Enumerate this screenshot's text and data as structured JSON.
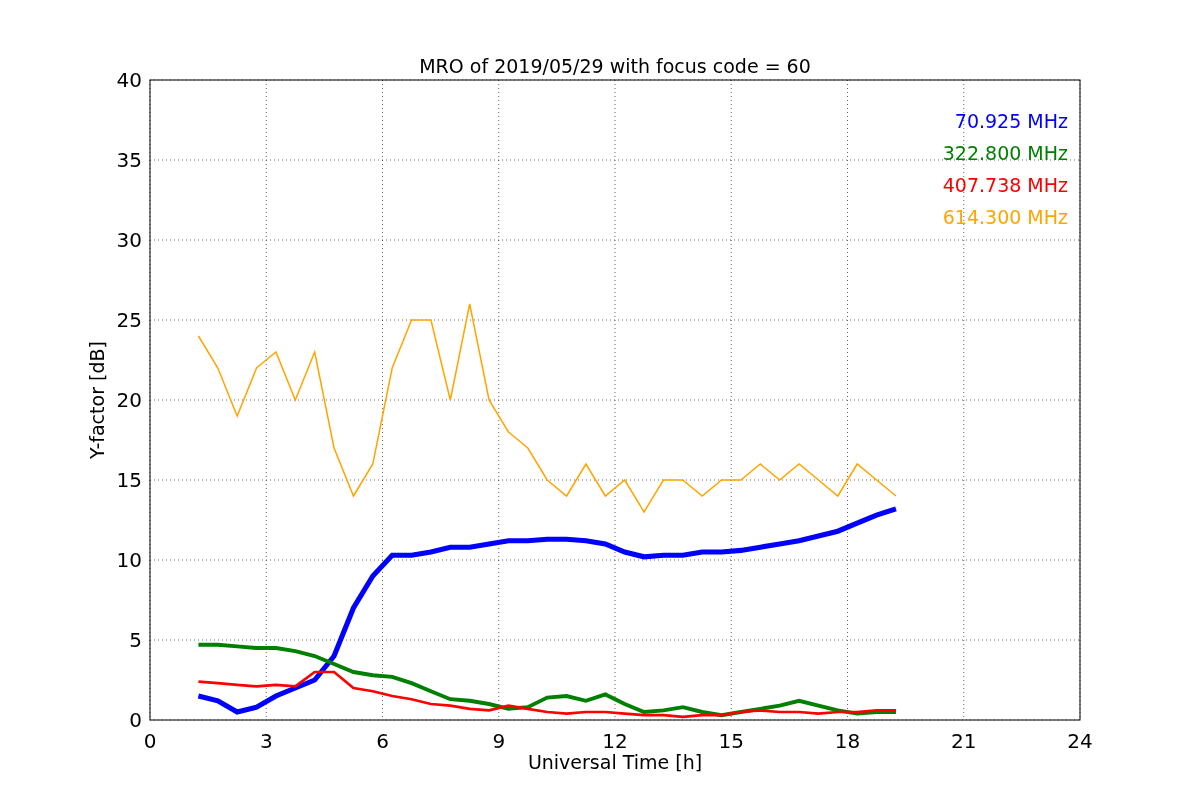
{
  "chart_data": {
    "type": "line",
    "title": "MRO of 2019/05/29 with focus code = 60",
    "xlabel": "Universal Time [h]",
    "ylabel": "Y-factor [dB]",
    "x": [
      1.25,
      1.75,
      2.25,
      2.75,
      3.25,
      3.75,
      4.25,
      4.75,
      5.25,
      5.75,
      6.25,
      6.75,
      7.25,
      7.75,
      8.25,
      8.75,
      9.25,
      9.75,
      10.25,
      10.75,
      11.25,
      11.75,
      12.25,
      12.75,
      13.25,
      13.75,
      14.25,
      14.75,
      15.25,
      15.75,
      16.25,
      16.75,
      17.25,
      17.75,
      18.25,
      18.75,
      19.25
    ],
    "series": [
      {
        "name": "70.925 MHz",
        "color": "#0000ff",
        "values": [
          1.5,
          1.2,
          0.5,
          0.8,
          1.5,
          2,
          2.5,
          4,
          7,
          9,
          10.3,
          10.3,
          10.5,
          10.8,
          10.8,
          11,
          11.2,
          11.2,
          11.3,
          11.3,
          11.2,
          11,
          10.5,
          10.2,
          10.3,
          10.3,
          10.5,
          10.5,
          10.6,
          10.8,
          11,
          11.2,
          11.5,
          11.8,
          12.3,
          12.8,
          13.2
        ]
      },
      {
        "name": "322.800 MHz",
        "color": "#008000",
        "values": [
          4.7,
          4.7,
          4.6,
          4.5,
          4.5,
          4.3,
          4,
          3.5,
          3,
          2.8,
          2.7,
          2.3,
          1.8,
          1.3,
          1.2,
          1,
          0.7,
          0.8,
          1.4,
          1.5,
          1.2,
          1.6,
          1,
          0.5,
          0.6,
          0.8,
          0.5,
          0.3,
          0.5,
          0.7,
          0.9,
          1.2,
          0.9,
          0.6,
          0.4,
          0.5,
          0.5
        ]
      },
      {
        "name": "407.738 MHz",
        "color": "#ff0000",
        "values": [
          2.4,
          2.3,
          2.2,
          2.1,
          2.2,
          2.1,
          3,
          3,
          2,
          1.8,
          1.5,
          1.3,
          1,
          0.9,
          0.7,
          0.6,
          0.9,
          0.7,
          0.5,
          0.4,
          0.5,
          0.5,
          0.4,
          0.3,
          0.3,
          0.2,
          0.3,
          0.3,
          0.5,
          0.6,
          0.5,
          0.5,
          0.4,
          0.5,
          0.5,
          0.6,
          0.6
        ]
      },
      {
        "name": "614.300 MHz",
        "color": "#ffa500",
        "values": [
          24,
          22,
          19,
          22,
          23,
          20,
          23,
          17,
          14,
          16,
          22,
          25,
          25,
          20,
          26,
          20,
          18,
          17,
          15,
          14,
          16,
          14,
          15,
          13,
          15,
          15,
          14,
          15,
          15,
          16,
          15,
          16,
          15,
          14,
          16,
          15,
          14
        ]
      }
    ],
    "grid": true,
    "xlim": [
      0,
      24
    ],
    "ylim": [
      0,
      40
    ],
    "xticks": [
      0,
      3,
      6,
      9,
      12,
      15,
      18,
      21,
      24
    ],
    "yticks": [
      0,
      5,
      10,
      15,
      20,
      25,
      30,
      35,
      40
    ]
  }
}
